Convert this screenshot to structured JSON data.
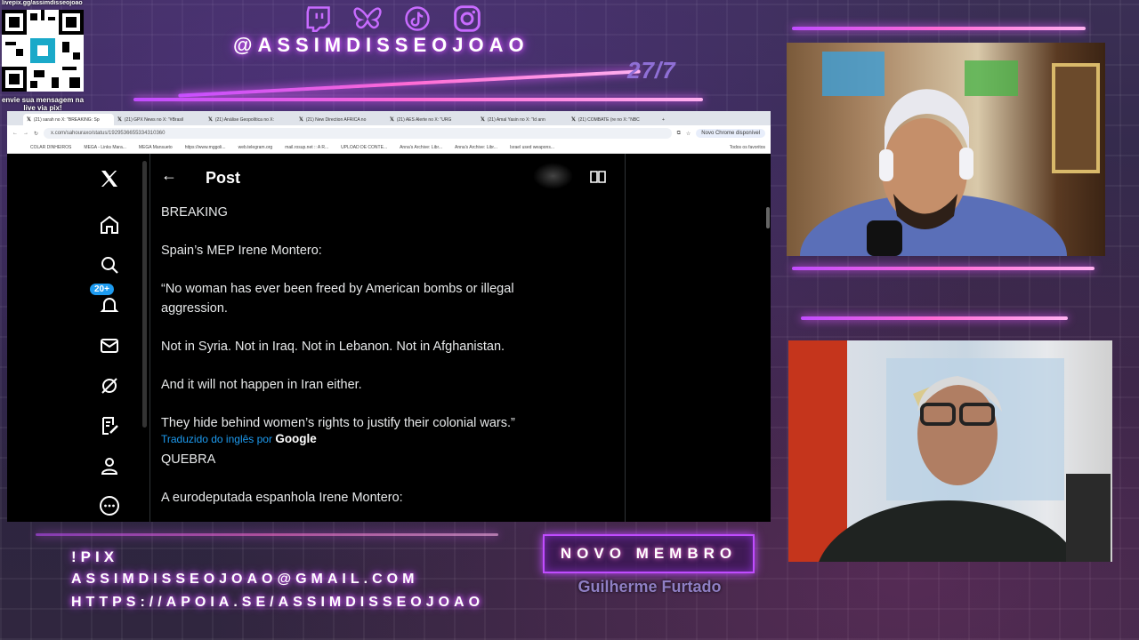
{
  "overlay": {
    "qr_link": "livepix.gg/assimdisseojoao",
    "qr_note": "envie sua mensagem na live via pix!",
    "handle": "@ASSIMDISSEOJOAO",
    "date": "27/7",
    "social_icons": [
      "twitch-icon",
      "bluesky-icon",
      "tiktok-icon",
      "instagram-icon"
    ],
    "pix_label": "!PIX",
    "pix_email": "ASSIMDISSEOJOAO@GMAIL.COM",
    "pix_url": "HTTPS://APOIA.SE/ASSIMDISSEOJOAO",
    "member_title": "NOVO MEMBRO",
    "member_name": "Guilherme Furtado"
  },
  "browser": {
    "tabs": [
      "(21) sarah no X: \"BREAKING: Sp",
      "(21) GPX News no X: \"#Brasil",
      "(21) Análise Geopolítica no X:",
      "(21) New Direction AFRICA no",
      "(21) AES Alerte no X: \"URG",
      "(21) Amal Yasin no X: \"Id ann",
      "(21) COMBATE (re no X: \"NBC"
    ],
    "url": "x.com/sahouraxo/status/1929536655334310360",
    "update_button": "Novo Chrome disponível",
    "bookmarks": [
      "COLAR DINHEIROS",
      "MEGA - Links Mara...",
      "MEGA Mansueto",
      "https://www.mggoli...",
      "web.telegram.org",
      "mail.rosup.net :: A R...",
      "UPLOAD DE CONTE...",
      "Anna's Archive: Libr...",
      "Anna's Archive: Libr...",
      "Israel used weapons...",
      "Todos os favoritos"
    ]
  },
  "x": {
    "notification_badge": "20+",
    "post_header": "Post",
    "lines": {
      "l1": "BREAKING",
      "l2": "Spain’s MEP Irene Montero:",
      "l3": "“No woman has ever been freed by American bombs or illegal aggression.",
      "l4": "Not in Syria. Not in Iraq. Not in Lebanon. Not in Afghanistan.",
      "l5": "And it will not happen in Iran either.",
      "l6": "They hide behind women’s rights to justify their colonial wars.”",
      "translated_prefix": "Traduzido do inglês por",
      "translated_brand": "Google",
      "t1": "QUEBRA",
      "t2": "A eurodeputada espanhola Irene Montero:"
    }
  },
  "colors": {
    "neon_pink": "#ff6bd5",
    "neon_purple": "#c04cff",
    "x_blue": "#1d9bf0"
  }
}
